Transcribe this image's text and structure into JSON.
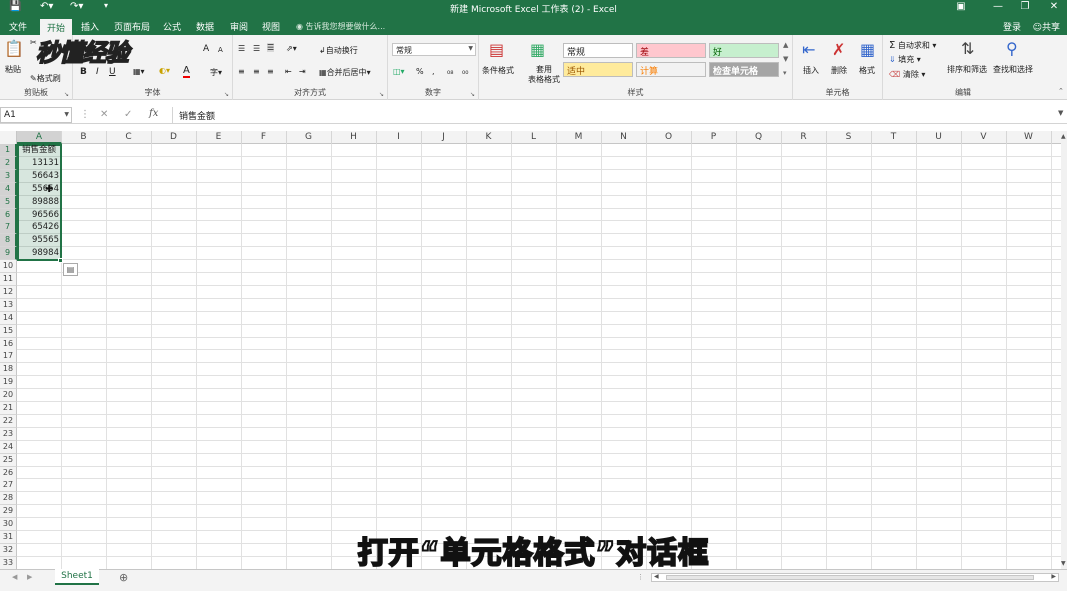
{
  "window": {
    "title": "新建 Microsoft Excel 工作表 (2) - Excel",
    "save_icon": "save-icon",
    "undo_icon": "undo-icon",
    "redo_icon": "redo-icon"
  },
  "tabs": [
    "文件",
    "开始",
    "插入",
    "页面布局",
    "公式",
    "数据",
    "审阅",
    "视图"
  ],
  "active_tab": "开始",
  "tell_me": "告诉我您想要做什么...",
  "account": {
    "login": "登录",
    "share": "共享"
  },
  "ribbon": {
    "clipboard": {
      "label": "剪贴板",
      "paste": "粘贴",
      "format_painter": "格式刷"
    },
    "font": {
      "label": "字体",
      "bold": "B",
      "italic": "I",
      "underline": "U",
      "grow": "A",
      "shrink": "A",
      "font_color": "A"
    },
    "alignment": {
      "label": "对齐方式",
      "wrap_text": "自动换行",
      "merge_center": "合并后居中"
    },
    "number": {
      "label": "数字",
      "format": "常规",
      "percent": "%",
      "comma": ","
    },
    "styles": {
      "label": "样式",
      "conditional": "条件格式",
      "table_format": "套用\n表格格式",
      "cells": [
        {
          "text": "常规",
          "bg": "#ffffff",
          "color": "#222222"
        },
        {
          "text": "差",
          "bg": "#ffc7ce",
          "color": "#9c0006"
        },
        {
          "text": "好",
          "bg": "#c6efce",
          "color": "#006100"
        },
        {
          "text": "适中",
          "bg": "#ffeb9c",
          "color": "#9c5700"
        },
        {
          "text": "计算",
          "bg": "#f2f2f2",
          "color": "#fa7d00"
        },
        {
          "text": "检查单元格",
          "bg": "#a5a5a5",
          "color": "#ffffff"
        }
      ]
    },
    "cells": {
      "label": "单元格",
      "insert": "插入",
      "delete": "删除",
      "format": "格式"
    },
    "editing": {
      "label": "编辑",
      "autosum": "自动求和",
      "fill": "填充",
      "clear": "清除",
      "sort_filter": "排序和筛选",
      "find_select": "查找和选择"
    }
  },
  "formula_bar": {
    "name_box": "A1",
    "fx": "fx",
    "content": "销售金额"
  },
  "columns": [
    "A",
    "B",
    "C",
    "D",
    "E",
    "F",
    "G",
    "H",
    "I",
    "J",
    "K",
    "L",
    "M",
    "N",
    "O",
    "P",
    "Q",
    "R",
    "S",
    "T",
    "U",
    "V",
    "W"
  ],
  "rows": [
    "1",
    "2",
    "3",
    "4",
    "5",
    "6",
    "7",
    "8",
    "9",
    "10",
    "11",
    "12",
    "13",
    "14",
    "15",
    "16",
    "17",
    "18",
    "19",
    "20",
    "21",
    "22",
    "23",
    "24",
    "25",
    "26",
    "27",
    "28",
    "29",
    "30",
    "31",
    "32",
    "33"
  ],
  "cells_a": [
    "销售金额",
    "13131",
    "56643",
    "55654",
    "89888",
    "96566",
    "65426",
    "95565",
    "98984"
  ],
  "sheet": {
    "active": "Sheet1"
  },
  "watermark": "秒懂经验",
  "subtitle": "打开“单元格格式”对话框",
  "accent_color": "#217346"
}
